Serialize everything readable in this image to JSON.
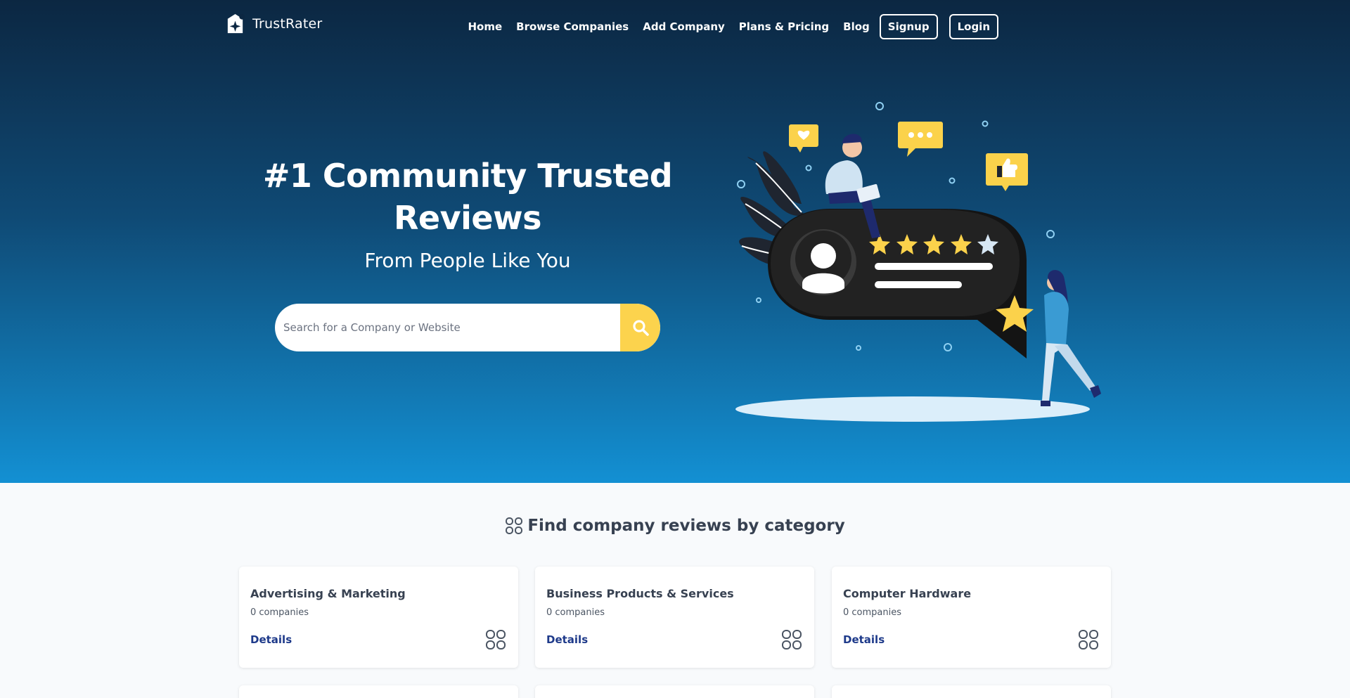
{
  "brand": {
    "name": "TrustRater"
  },
  "nav": {
    "links": [
      "Home",
      "Browse Companies",
      "Add Company",
      "Plans & Pricing",
      "Blog"
    ],
    "signup": "Signup",
    "login": "Login"
  },
  "hero": {
    "title_line1": "#1 Community Trusted",
    "title_line2": "Reviews",
    "subtitle": "From People Like You",
    "search_placeholder": "Search for a Company or Website"
  },
  "categories": {
    "heading": "Find company reviews by category",
    "items": [
      {
        "name": "Advertising & Marketing",
        "count": "0 companies",
        "link": "Details"
      },
      {
        "name": "Business Products & Services",
        "count": "0 companies",
        "link": "Details"
      },
      {
        "name": "Computer Hardware",
        "count": "0 companies",
        "link": "Details"
      }
    ]
  },
  "colors": {
    "hero_top": "#0c2742",
    "hero_bottom": "#1390d3",
    "accent_yellow": "#fcd34d",
    "link_blue": "#1e3a8a"
  },
  "icons": [
    "logo-mark-icon",
    "search-icon",
    "grid-icon"
  ]
}
